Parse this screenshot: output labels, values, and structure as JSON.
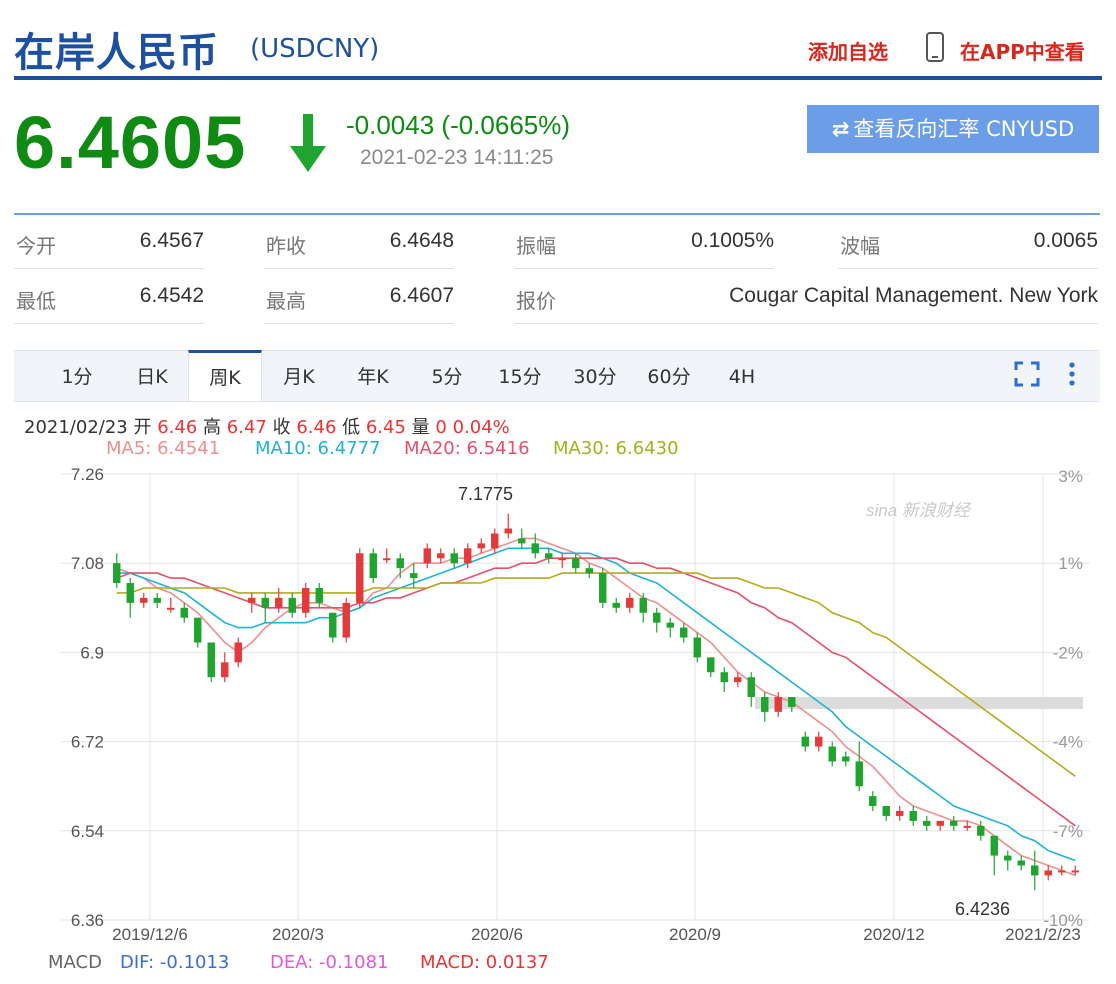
{
  "header": {
    "title": "在岸人民币",
    "code": "(USDCNY)",
    "add_watchlist": "添加自选",
    "view_in_app": "在APP中查看"
  },
  "quote": {
    "price": "6.4605",
    "change": "-0.0043 (-0.0665%)",
    "timestamp": "2021-02-23 14:11:25",
    "reverse_rate_button": "查看反向汇率 CNYUSD",
    "price_color": "#0f8a12"
  },
  "stats": [
    {
      "label": "今开",
      "value": "6.4567"
    },
    {
      "label": "昨收",
      "value": "6.4648"
    },
    {
      "label": "振幅",
      "value": "0.1005%"
    },
    {
      "label": "波幅",
      "value": "0.0065"
    },
    {
      "label": "最低",
      "value": "6.4542"
    },
    {
      "label": "最高",
      "value": "6.4607"
    },
    {
      "label": "报价",
      "value": "Cougar Capital Management. New York"
    }
  ],
  "tabs": [
    "1分",
    "日K",
    "周K",
    "月K",
    "年K",
    "5分",
    "15分",
    "30分",
    "60分",
    "4H"
  ],
  "active_tab": "周K",
  "info_line": {
    "date": "2021/02/23",
    "open_label": "开",
    "open": "6.46",
    "high_label": "高",
    "high": "6.47",
    "close_label": "收",
    "close": "6.46",
    "low_label": "低",
    "low": "6.45",
    "vol_label": "量",
    "vol": "0",
    "pct": "0.04%"
  },
  "ma_values": [
    {
      "text": "MA5: 6.4541",
      "color": "#f08f8f"
    },
    {
      "text": "MA10: 6.4777",
      "color": "#1fb3d6"
    },
    {
      "text": "MA20: 6.5416",
      "color": "#e8506a"
    },
    {
      "text": "MA30: 6.6430",
      "color": "#9fb31c"
    }
  ],
  "macd": {
    "label": "MACD",
    "dif": "DIF: -0.1013",
    "dea": "DEA: -0.1081",
    "macd": "MACD: 0.0137",
    "dif_color": "#3b6fd1",
    "dea_color": "#e05ad8",
    "macd_color": "#e33"
  },
  "watermark": "sina 新浪财经",
  "chart_data": {
    "type": "candlestick",
    "ylim": [
      6.36,
      7.26
    ],
    "y_ticks": [
      "7.26",
      "7.08",
      "6.9",
      "6.72",
      "6.54",
      "6.36"
    ],
    "pct_ticks": [
      "3%",
      "1%",
      "-2%",
      "-4%",
      "-7%",
      "-10%"
    ],
    "x_ticks": [
      "2019/12/6",
      "2020/3",
      "2020/6",
      "2020/9",
      "2020/12",
      "2021/2/23"
    ],
    "annotations": [
      {
        "text": "7.1775"
      },
      {
        "text": "6.4236"
      }
    ],
    "up_color": "#e33b3b",
    "down_color": "#1fa52f",
    "candles": [
      [
        7.08,
        7.04,
        7.1,
        7.03
      ],
      [
        7.04,
        7.0,
        7.05,
        6.97
      ],
      [
        7.0,
        7.01,
        7.02,
        6.99
      ],
      [
        7.01,
        7.0,
        7.02,
        6.99
      ],
      [
        6.99,
        6.99,
        7.01,
        6.98
      ],
      [
        6.99,
        6.97,
        7.0,
        6.96
      ],
      [
        6.97,
        6.92,
        6.97,
        6.91
      ],
      [
        6.92,
        6.85,
        6.92,
        6.84
      ],
      [
        6.85,
        6.88,
        6.9,
        6.84
      ],
      [
        6.88,
        6.92,
        6.93,
        6.87
      ],
      [
        7.0,
        7.01,
        7.02,
        6.98
      ],
      [
        7.01,
        6.99,
        7.02,
        6.96
      ],
      [
        6.99,
        7.01,
        7.03,
        6.98
      ],
      [
        7.01,
        6.98,
        7.02,
        6.97
      ],
      [
        6.98,
        7.03,
        7.04,
        6.97
      ],
      [
        7.03,
        7.0,
        7.04,
        6.99
      ],
      [
        6.98,
        6.93,
        6.98,
        6.92
      ],
      [
        6.93,
        7.0,
        7.01,
        6.92
      ],
      [
        7.0,
        7.1,
        7.11,
        6.99
      ],
      [
        7.1,
        7.05,
        7.11,
        7.04
      ],
      [
        7.09,
        7.09,
        7.11,
        7.08
      ],
      [
        7.09,
        7.07,
        7.1,
        7.05
      ],
      [
        7.06,
        7.05,
        7.08,
        7.03
      ],
      [
        7.08,
        7.11,
        7.12,
        7.07
      ],
      [
        7.09,
        7.1,
        7.11,
        7.08
      ],
      [
        7.1,
        7.08,
        7.11,
        7.07
      ],
      [
        7.08,
        7.11,
        7.12,
        7.07
      ],
      [
        7.11,
        7.12,
        7.13,
        7.1
      ],
      [
        7.11,
        7.14,
        7.15,
        7.1
      ],
      [
        7.14,
        7.15,
        7.18,
        7.13
      ],
      [
        7.13,
        7.12,
        7.15,
        7.11
      ],
      [
        7.12,
        7.1,
        7.14,
        7.09
      ],
      [
        7.1,
        7.09,
        7.11,
        7.08
      ],
      [
        7.09,
        7.09,
        7.1,
        7.07
      ],
      [
        7.09,
        7.07,
        7.1,
        7.06
      ],
      [
        7.07,
        7.06,
        7.08,
        7.05
      ],
      [
        7.06,
        7.0,
        7.07,
        6.99
      ],
      [
        7.0,
        6.99,
        7.01,
        6.98
      ],
      [
        6.99,
        7.01,
        7.02,
        6.98
      ],
      [
        7.01,
        6.98,
        7.02,
        6.96
      ],
      [
        6.98,
        6.96,
        6.99,
        6.94
      ],
      [
        6.96,
        6.95,
        6.97,
        6.93
      ],
      [
        6.95,
        6.93,
        6.96,
        6.92
      ],
      [
        6.93,
        6.89,
        6.94,
        6.88
      ],
      [
        6.89,
        6.86,
        6.89,
        6.85
      ],
      [
        6.86,
        6.84,
        6.87,
        6.82
      ],
      [
        6.84,
        6.85,
        6.86,
        6.83
      ],
      [
        6.85,
        6.81,
        6.86,
        6.79
      ],
      [
        6.81,
        6.78,
        6.82,
        6.76
      ],
      [
        6.78,
        6.81,
        6.82,
        6.77
      ],
      [
        6.81,
        6.79,
        6.81,
        6.78
      ],
      [
        6.73,
        6.71,
        6.74,
        6.7
      ],
      [
        6.71,
        6.73,
        6.74,
        6.7
      ],
      [
        6.71,
        6.68,
        6.72,
        6.67
      ],
      [
        6.69,
        6.68,
        6.7,
        6.67
      ],
      [
        6.68,
        6.63,
        6.72,
        6.62
      ],
      [
        6.61,
        6.59,
        6.62,
        6.58
      ],
      [
        6.59,
        6.57,
        6.59,
        6.56
      ],
      [
        6.57,
        6.58,
        6.59,
        6.56
      ],
      [
        6.58,
        6.56,
        6.59,
        6.55
      ],
      [
        6.56,
        6.55,
        6.57,
        6.54
      ],
      [
        6.55,
        6.56,
        6.56,
        6.54
      ],
      [
        6.56,
        6.55,
        6.57,
        6.54
      ],
      [
        6.55,
        6.55,
        6.56,
        6.54
      ],
      [
        6.55,
        6.53,
        6.56,
        6.52
      ],
      [
        6.53,
        6.49,
        6.53,
        6.45
      ],
      [
        6.49,
        6.48,
        6.5,
        6.46
      ],
      [
        6.48,
        6.47,
        6.49,
        6.46
      ],
      [
        6.47,
        6.45,
        6.5,
        6.42
      ],
      [
        6.45,
        6.46,
        6.47,
        6.44
      ],
      [
        6.46,
        6.46,
        6.47,
        6.45
      ],
      [
        6.46,
        6.46,
        6.47,
        6.45
      ]
    ],
    "series": [
      {
        "name": "MA5",
        "color": "#f08f8f",
        "values": [
          7.07,
          7.06,
          7.05,
          7.03,
          7.02,
          7.0,
          6.98,
          6.95,
          6.92,
          6.9,
          6.92,
          6.95,
          6.97,
          6.99,
          7.0,
          7.0,
          6.99,
          6.98,
          6.99,
          7.02,
          7.03,
          7.06,
          7.08,
          7.08,
          7.08,
          7.09,
          7.09,
          7.1,
          7.11,
          7.12,
          7.13,
          7.13,
          7.12,
          7.11,
          7.1,
          7.08,
          7.07,
          7.05,
          7.03,
          7.01,
          7.0,
          6.98,
          6.96,
          6.94,
          6.92,
          6.89,
          6.86,
          6.84,
          6.82,
          6.81,
          6.8,
          6.78,
          6.76,
          6.74,
          6.71,
          6.69,
          6.67,
          6.64,
          6.61,
          6.59,
          6.58,
          6.57,
          6.56,
          6.56,
          6.55,
          6.53,
          6.51,
          6.49,
          6.48,
          6.47,
          6.46,
          6.45
        ]
      },
      {
        "name": "MA10",
        "color": "#1fb3d6",
        "values": [
          7.06,
          7.06,
          7.05,
          7.04,
          7.03,
          7.02,
          7.0,
          6.98,
          6.96,
          6.95,
          6.95,
          6.96,
          6.96,
          6.96,
          6.96,
          6.97,
          6.97,
          6.98,
          6.99,
          7.01,
          7.02,
          7.03,
          7.04,
          7.05,
          7.06,
          7.07,
          7.08,
          7.09,
          7.1,
          7.11,
          7.11,
          7.11,
          7.11,
          7.1,
          7.1,
          7.1,
          7.09,
          7.08,
          7.06,
          7.05,
          7.04,
          7.02,
          7.0,
          6.98,
          6.96,
          6.94,
          6.92,
          6.9,
          6.88,
          6.86,
          6.84,
          6.82,
          6.8,
          6.78,
          6.75,
          6.73,
          6.71,
          6.69,
          6.67,
          6.65,
          6.63,
          6.61,
          6.59,
          6.58,
          6.57,
          6.56,
          6.55,
          6.53,
          6.52,
          6.5,
          6.49,
          6.48
        ]
      },
      {
        "name": "MA20",
        "color": "#e8506a",
        "values": [
          7.05,
          7.06,
          7.06,
          7.06,
          7.05,
          7.05,
          7.04,
          7.03,
          7.02,
          7.01,
          7.0,
          6.99,
          6.99,
          6.99,
          6.99,
          6.99,
          6.99,
          6.99,
          7.0,
          7.0,
          7.01,
          7.01,
          7.02,
          7.03,
          7.04,
          7.04,
          7.05,
          7.06,
          7.07,
          7.07,
          7.08,
          7.08,
          7.09,
          7.09,
          7.09,
          7.09,
          7.09,
          7.09,
          7.08,
          7.08,
          7.07,
          7.07,
          7.06,
          7.05,
          7.04,
          7.03,
          7.02,
          7.0,
          6.99,
          6.97,
          6.96,
          6.94,
          6.92,
          6.9,
          6.89,
          6.87,
          6.85,
          6.83,
          6.81,
          6.79,
          6.77,
          6.75,
          6.73,
          6.71,
          6.69,
          6.67,
          6.65,
          6.63,
          6.61,
          6.59,
          6.57,
          6.55
        ]
      },
      {
        "name": "MA30",
        "color": "#b4ab1c",
        "values": [
          7.02,
          7.02,
          7.03,
          7.03,
          7.03,
          7.03,
          7.03,
          7.03,
          7.03,
          7.02,
          7.02,
          7.02,
          7.02,
          7.02,
          7.02,
          7.02,
          7.02,
          7.02,
          7.02,
          7.03,
          7.03,
          7.03,
          7.03,
          7.03,
          7.04,
          7.04,
          7.04,
          7.04,
          7.05,
          7.05,
          7.05,
          7.05,
          7.05,
          7.06,
          7.06,
          7.06,
          7.06,
          7.06,
          7.06,
          7.06,
          7.06,
          7.06,
          7.06,
          7.06,
          7.05,
          7.05,
          7.05,
          7.04,
          7.03,
          7.03,
          7.02,
          7.01,
          7.0,
          6.98,
          6.97,
          6.96,
          6.94,
          6.93,
          6.91,
          6.89,
          6.87,
          6.85,
          6.83,
          6.81,
          6.79,
          6.77,
          6.75,
          6.73,
          6.71,
          6.69,
          6.67,
          6.65
        ]
      }
    ]
  }
}
